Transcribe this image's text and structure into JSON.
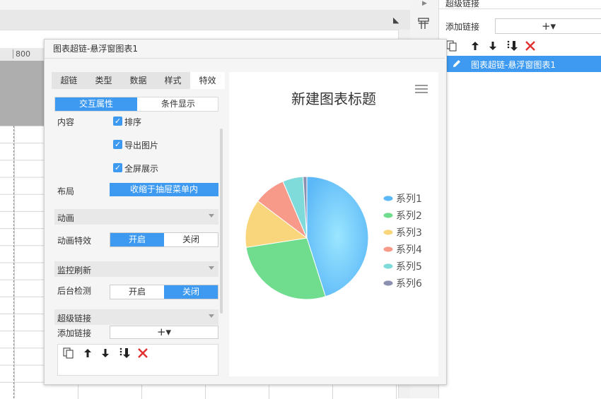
{
  "editor": {
    "ruler_label": "800"
  },
  "right_panel": {
    "title": "超级链接",
    "add_link_label": "添加链接",
    "add_button": "+▾",
    "list": [
      {
        "label": "图表超链-悬浮窗图表1"
      }
    ]
  },
  "dialog": {
    "title": "图表超链-悬浮窗图表1",
    "tabs": [
      {
        "label": "超链",
        "active": false
      },
      {
        "label": "类型",
        "active": false
      },
      {
        "label": "数据",
        "active": false
      },
      {
        "label": "样式",
        "active": false
      },
      {
        "label": "特效",
        "active": true
      }
    ],
    "subtabs": [
      {
        "label": "交互属性",
        "active": true
      },
      {
        "label": "条件显示",
        "active": false
      }
    ],
    "content_label": "内容",
    "checkboxes": [
      {
        "label": "排序",
        "checked": true
      },
      {
        "label": "导出图片",
        "checked": true
      },
      {
        "label": "全屏展示",
        "checked": true
      }
    ],
    "layout_label": "布局",
    "layout_value": "收缩于抽屉菜单内",
    "sections": {
      "animation": "动画",
      "monitor": "监控刷新",
      "hyperlink": "超级链接"
    },
    "animation_effect_label": "动画特效",
    "animation_toggle": {
      "on": "开启",
      "off": "关闭",
      "selected": "开启"
    },
    "background_check_label": "后台检测",
    "background_toggle": {
      "on": "开启",
      "off": "关闭",
      "selected": "关闭"
    },
    "add_link_label": "添加链接",
    "add_button": "+▾"
  },
  "chart_data": {
    "type": "pie",
    "title": "新建图表标题",
    "legend_position": "right",
    "series": [
      {
        "name": "系列1",
        "value": 46,
        "color": "#5cb8f7"
      },
      {
        "name": "系列2",
        "value": 28,
        "color": "#6fdd8d"
      },
      {
        "name": "系列3",
        "value": 13,
        "color": "#f9d57b"
      },
      {
        "name": "系列4",
        "value": 8.5,
        "color": "#f89a8a"
      },
      {
        "name": "系列5",
        "value": 5.5,
        "color": "#7fdada"
      },
      {
        "name": "系列6",
        "value": 1,
        "color": "#8b8fb0"
      }
    ]
  }
}
